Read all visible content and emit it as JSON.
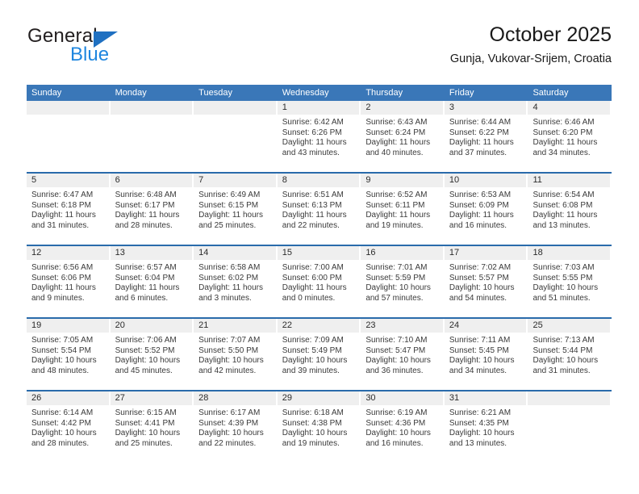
{
  "brand": {
    "name_part1": "General",
    "name_part2": "Blue",
    "logo_icon": "triangle-icon"
  },
  "header": {
    "title": "October 2025",
    "subtitle": "Gunja, Vukovar-Srijem, Croatia"
  },
  "colors": {
    "header_blue": "#3a77b8",
    "row_divider_blue": "#2a6bab",
    "date_band_gray": "#efefef",
    "brand_blue": "#1f86df",
    "logo_blue": "#1f70c1"
  },
  "weekdays": [
    "Sunday",
    "Monday",
    "Tuesday",
    "Wednesday",
    "Thursday",
    "Friday",
    "Saturday"
  ],
  "weeks": [
    [
      {
        "date": "",
        "sunrise": "",
        "sunset": "",
        "daylight_line1": "",
        "daylight_line2": ""
      },
      {
        "date": "",
        "sunrise": "",
        "sunset": "",
        "daylight_line1": "",
        "daylight_line2": ""
      },
      {
        "date": "",
        "sunrise": "",
        "sunset": "",
        "daylight_line1": "",
        "daylight_line2": ""
      },
      {
        "date": "1",
        "sunrise": "Sunrise: 6:42 AM",
        "sunset": "Sunset: 6:26 PM",
        "daylight_line1": "Daylight: 11 hours",
        "daylight_line2": "and 43 minutes."
      },
      {
        "date": "2",
        "sunrise": "Sunrise: 6:43 AM",
        "sunset": "Sunset: 6:24 PM",
        "daylight_line1": "Daylight: 11 hours",
        "daylight_line2": "and 40 minutes."
      },
      {
        "date": "3",
        "sunrise": "Sunrise: 6:44 AM",
        "sunset": "Sunset: 6:22 PM",
        "daylight_line1": "Daylight: 11 hours",
        "daylight_line2": "and 37 minutes."
      },
      {
        "date": "4",
        "sunrise": "Sunrise: 6:46 AM",
        "sunset": "Sunset: 6:20 PM",
        "daylight_line1": "Daylight: 11 hours",
        "daylight_line2": "and 34 minutes."
      }
    ],
    [
      {
        "date": "5",
        "sunrise": "Sunrise: 6:47 AM",
        "sunset": "Sunset: 6:18 PM",
        "daylight_line1": "Daylight: 11 hours",
        "daylight_line2": "and 31 minutes."
      },
      {
        "date": "6",
        "sunrise": "Sunrise: 6:48 AM",
        "sunset": "Sunset: 6:17 PM",
        "daylight_line1": "Daylight: 11 hours",
        "daylight_line2": "and 28 minutes."
      },
      {
        "date": "7",
        "sunrise": "Sunrise: 6:49 AM",
        "sunset": "Sunset: 6:15 PM",
        "daylight_line1": "Daylight: 11 hours",
        "daylight_line2": "and 25 minutes."
      },
      {
        "date": "8",
        "sunrise": "Sunrise: 6:51 AM",
        "sunset": "Sunset: 6:13 PM",
        "daylight_line1": "Daylight: 11 hours",
        "daylight_line2": "and 22 minutes."
      },
      {
        "date": "9",
        "sunrise": "Sunrise: 6:52 AM",
        "sunset": "Sunset: 6:11 PM",
        "daylight_line1": "Daylight: 11 hours",
        "daylight_line2": "and 19 minutes."
      },
      {
        "date": "10",
        "sunrise": "Sunrise: 6:53 AM",
        "sunset": "Sunset: 6:09 PM",
        "daylight_line1": "Daylight: 11 hours",
        "daylight_line2": "and 16 minutes."
      },
      {
        "date": "11",
        "sunrise": "Sunrise: 6:54 AM",
        "sunset": "Sunset: 6:08 PM",
        "daylight_line1": "Daylight: 11 hours",
        "daylight_line2": "and 13 minutes."
      }
    ],
    [
      {
        "date": "12",
        "sunrise": "Sunrise: 6:56 AM",
        "sunset": "Sunset: 6:06 PM",
        "daylight_line1": "Daylight: 11 hours",
        "daylight_line2": "and 9 minutes."
      },
      {
        "date": "13",
        "sunrise": "Sunrise: 6:57 AM",
        "sunset": "Sunset: 6:04 PM",
        "daylight_line1": "Daylight: 11 hours",
        "daylight_line2": "and 6 minutes."
      },
      {
        "date": "14",
        "sunrise": "Sunrise: 6:58 AM",
        "sunset": "Sunset: 6:02 PM",
        "daylight_line1": "Daylight: 11 hours",
        "daylight_line2": "and 3 minutes."
      },
      {
        "date": "15",
        "sunrise": "Sunrise: 7:00 AM",
        "sunset": "Sunset: 6:00 PM",
        "daylight_line1": "Daylight: 11 hours",
        "daylight_line2": "and 0 minutes."
      },
      {
        "date": "16",
        "sunrise": "Sunrise: 7:01 AM",
        "sunset": "Sunset: 5:59 PM",
        "daylight_line1": "Daylight: 10 hours",
        "daylight_line2": "and 57 minutes."
      },
      {
        "date": "17",
        "sunrise": "Sunrise: 7:02 AM",
        "sunset": "Sunset: 5:57 PM",
        "daylight_line1": "Daylight: 10 hours",
        "daylight_line2": "and 54 minutes."
      },
      {
        "date": "18",
        "sunrise": "Sunrise: 7:03 AM",
        "sunset": "Sunset: 5:55 PM",
        "daylight_line1": "Daylight: 10 hours",
        "daylight_line2": "and 51 minutes."
      }
    ],
    [
      {
        "date": "19",
        "sunrise": "Sunrise: 7:05 AM",
        "sunset": "Sunset: 5:54 PM",
        "daylight_line1": "Daylight: 10 hours",
        "daylight_line2": "and 48 minutes."
      },
      {
        "date": "20",
        "sunrise": "Sunrise: 7:06 AM",
        "sunset": "Sunset: 5:52 PM",
        "daylight_line1": "Daylight: 10 hours",
        "daylight_line2": "and 45 minutes."
      },
      {
        "date": "21",
        "sunrise": "Sunrise: 7:07 AM",
        "sunset": "Sunset: 5:50 PM",
        "daylight_line1": "Daylight: 10 hours",
        "daylight_line2": "and 42 minutes."
      },
      {
        "date": "22",
        "sunrise": "Sunrise: 7:09 AM",
        "sunset": "Sunset: 5:49 PM",
        "daylight_line1": "Daylight: 10 hours",
        "daylight_line2": "and 39 minutes."
      },
      {
        "date": "23",
        "sunrise": "Sunrise: 7:10 AM",
        "sunset": "Sunset: 5:47 PM",
        "daylight_line1": "Daylight: 10 hours",
        "daylight_line2": "and 36 minutes."
      },
      {
        "date": "24",
        "sunrise": "Sunrise: 7:11 AM",
        "sunset": "Sunset: 5:45 PM",
        "daylight_line1": "Daylight: 10 hours",
        "daylight_line2": "and 34 minutes."
      },
      {
        "date": "25",
        "sunrise": "Sunrise: 7:13 AM",
        "sunset": "Sunset: 5:44 PM",
        "daylight_line1": "Daylight: 10 hours",
        "daylight_line2": "and 31 minutes."
      }
    ],
    [
      {
        "date": "26",
        "sunrise": "Sunrise: 6:14 AM",
        "sunset": "Sunset: 4:42 PM",
        "daylight_line1": "Daylight: 10 hours",
        "daylight_line2": "and 28 minutes."
      },
      {
        "date": "27",
        "sunrise": "Sunrise: 6:15 AM",
        "sunset": "Sunset: 4:41 PM",
        "daylight_line1": "Daylight: 10 hours",
        "daylight_line2": "and 25 minutes."
      },
      {
        "date": "28",
        "sunrise": "Sunrise: 6:17 AM",
        "sunset": "Sunset: 4:39 PM",
        "daylight_line1": "Daylight: 10 hours",
        "daylight_line2": "and 22 minutes."
      },
      {
        "date": "29",
        "sunrise": "Sunrise: 6:18 AM",
        "sunset": "Sunset: 4:38 PM",
        "daylight_line1": "Daylight: 10 hours",
        "daylight_line2": "and 19 minutes."
      },
      {
        "date": "30",
        "sunrise": "Sunrise: 6:19 AM",
        "sunset": "Sunset: 4:36 PM",
        "daylight_line1": "Daylight: 10 hours",
        "daylight_line2": "and 16 minutes."
      },
      {
        "date": "31",
        "sunrise": "Sunrise: 6:21 AM",
        "sunset": "Sunset: 4:35 PM",
        "daylight_line1": "Daylight: 10 hours",
        "daylight_line2": "and 13 minutes."
      },
      {
        "date": "",
        "sunrise": "",
        "sunset": "",
        "daylight_line1": "",
        "daylight_line2": ""
      }
    ]
  ]
}
